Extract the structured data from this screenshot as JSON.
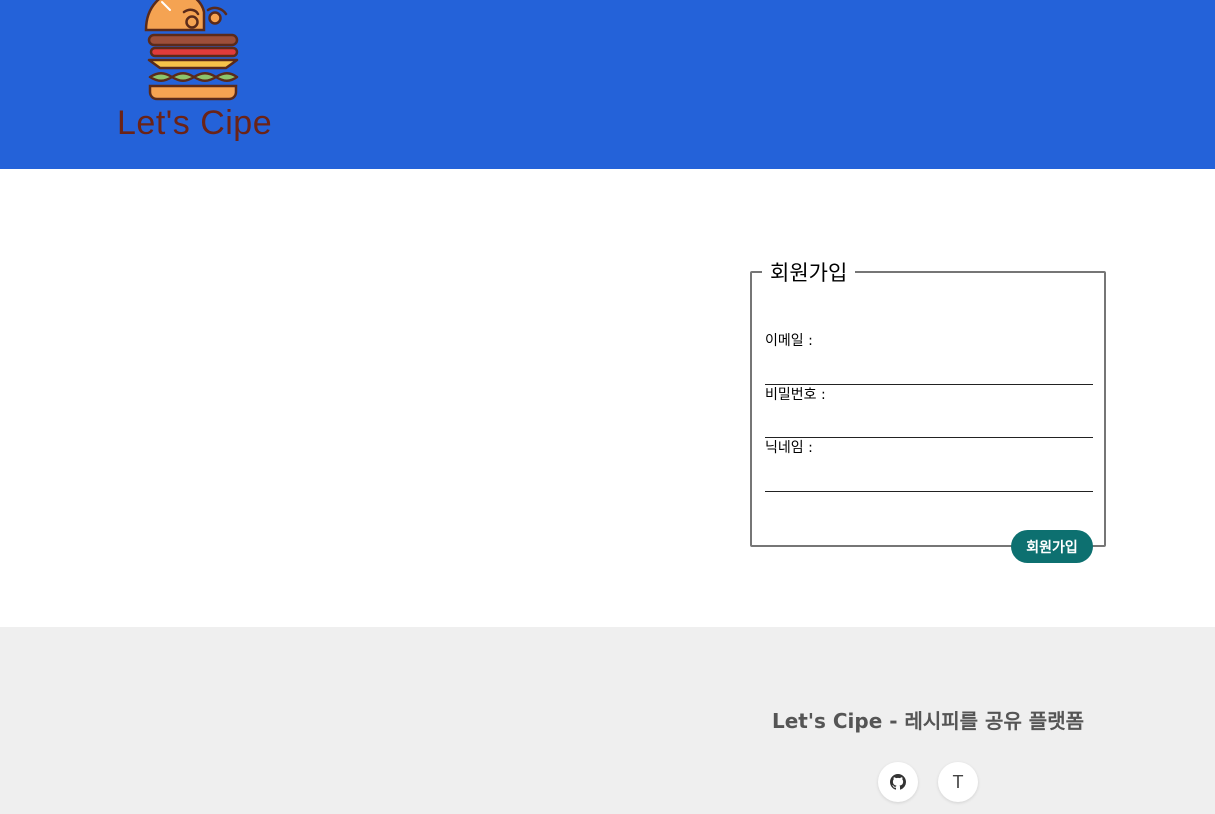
{
  "header": {
    "logo_text": "Let's Cipe",
    "background": "#2462d9",
    "logo_text_color": "#6b2317"
  },
  "signup_form": {
    "legend": "회원가입",
    "fields": [
      {
        "label": "이메일 :",
        "value": ""
      },
      {
        "label": "비밀번호 :",
        "value": ""
      },
      {
        "label": "닉네임 :",
        "value": ""
      }
    ],
    "submit_label": "회원가입",
    "submit_color": "#0d7070"
  },
  "footer": {
    "title": "Let's Cipe - 레시피를 공유 플랫폼",
    "background": "#efefef",
    "links": [
      {
        "icon": "github-icon"
      },
      {
        "icon": "tistory-icon",
        "glyph": "T"
      }
    ]
  }
}
